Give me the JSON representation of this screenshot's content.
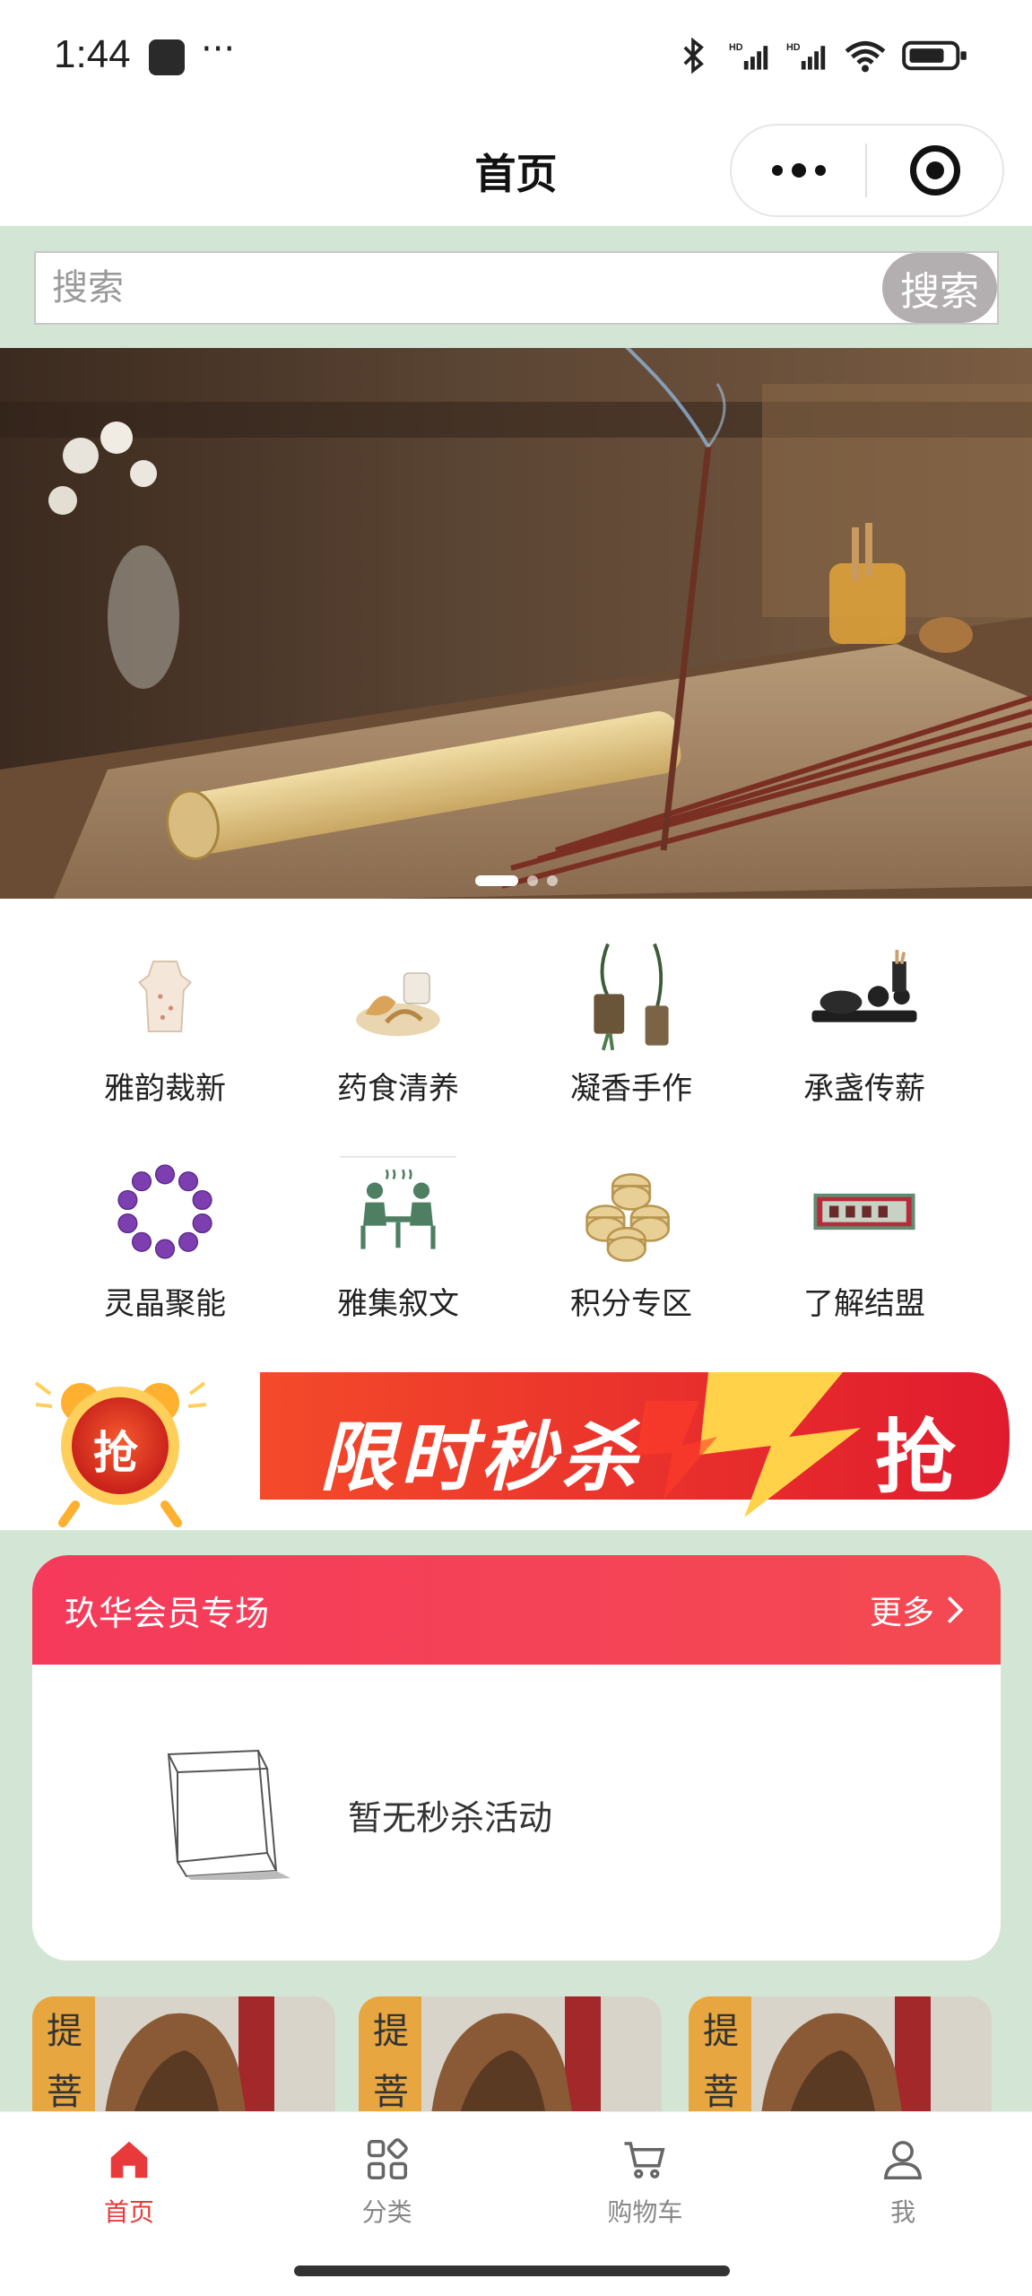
{
  "status_bar": {
    "time": "1:44",
    "dots": "···",
    "icons": [
      "bluetooth-icon",
      "signal-hd-icon",
      "signal-hd-icon",
      "wifi-icon",
      "battery-icon"
    ]
  },
  "nav": {
    "title": "首页"
  },
  "search": {
    "placeholder": "搜索",
    "button_label": "搜索"
  },
  "banner": {
    "slide_count": 3,
    "active_index": 0
  },
  "categories": [
    {
      "label": "雅韵裁新",
      "icon": "qipao-dress-icon"
    },
    {
      "label": "药食清养",
      "icon": "herbal-food-icon"
    },
    {
      "label": "凝香手作",
      "icon": "incense-pendant-icon"
    },
    {
      "label": "承盏传薪",
      "icon": "tea-set-icon"
    },
    {
      "label": "灵晶聚能",
      "icon": "amethyst-bracelet-icon"
    },
    {
      "label": "雅集叙文",
      "icon": "gathering-icon"
    },
    {
      "label": "积分专区",
      "icon": "coins-icon"
    },
    {
      "label": "了解结盟",
      "icon": "plaque-icon"
    }
  ],
  "flash_sale": {
    "badge": "抢",
    "title": "限时秒杀",
    "action": "抢"
  },
  "member": {
    "title": "玖华会员专场",
    "more": "更多",
    "empty_text": "暂无秒杀活动"
  },
  "tabs": [
    {
      "label": "首页",
      "icon": "home-icon",
      "active": true
    },
    {
      "label": "分类",
      "icon": "category-icon",
      "active": false
    },
    {
      "label": "购物车",
      "icon": "cart-icon",
      "active": false
    },
    {
      "label": "我",
      "icon": "user-icon",
      "active": false
    }
  ],
  "colors": {
    "accent": "#e83a3a",
    "mint_background": "#d3e6d6",
    "member_header": "#f53a5b"
  }
}
